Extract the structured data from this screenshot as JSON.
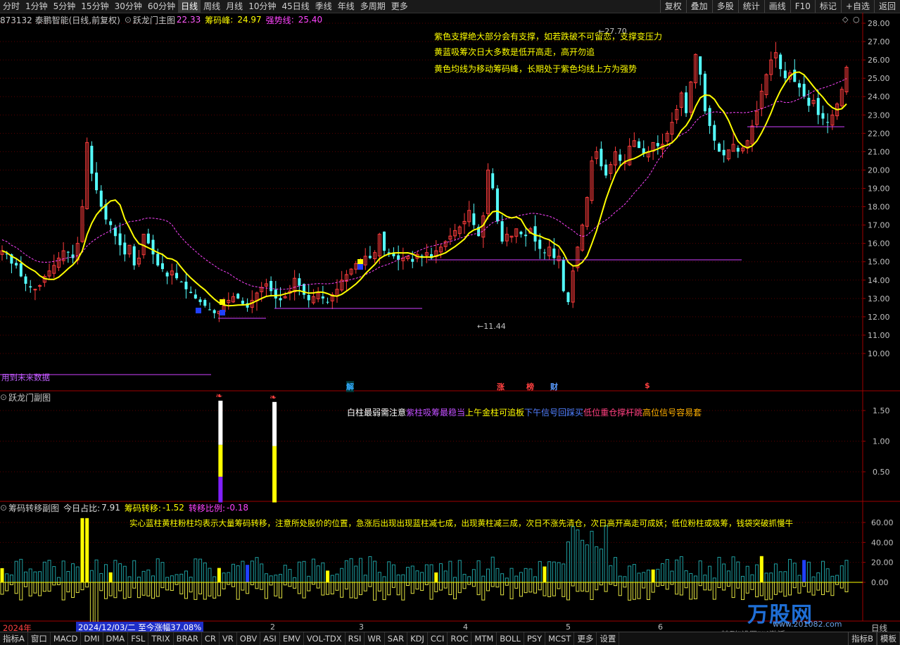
{
  "toolbar": {
    "periods": [
      "分时",
      "1分钟",
      "5分钟",
      "15分钟",
      "30分钟",
      "60分钟",
      "日线",
      "周线",
      "月线",
      "10分钟",
      "45日线",
      "季线",
      "年线",
      "多周期",
      "更多"
    ],
    "active_period": "日线",
    "right_items": [
      "复权",
      "叠加",
      "多股",
      "统计",
      "画线",
      "F10",
      "标记",
      "+自选",
      "返回"
    ]
  },
  "main_panel": {
    "stock": "873132 泰鹏智能(日线,前复权)",
    "indicator_name": "跃龙门主图",
    "value1": "22.33",
    "label2": "筹码峰",
    "value2": "24.97",
    "label3": "强势线",
    "value3": "25.40",
    "notes": [
      "紫色支撑绝大部分会有支撑，如若跌破不可留恋，支撑变压力",
      "黄蓝吸筹次日大多数是低开高走，高开勿追",
      "黄色均线为移动筹码峰，长期处于紫色均线上方为强势"
    ],
    "high_label": "27.70",
    "low_label": "11.44",
    "future_label": "用到未来数据",
    "signals": [
      "解",
      "涨",
      "榜",
      "财",
      "$"
    ]
  },
  "sub_panel": {
    "title": "跃龙门副图",
    "legend": [
      {
        "text": "白柱最弱需注意",
        "color": "#ffffff"
      },
      {
        "text": "紫柱吸筹最稳当",
        "color": "#c050ff"
      },
      {
        "text": "上午金柱可追板",
        "color": "#ffff00"
      },
      {
        "text": "下午信号回踩买",
        "color": "#5080ff"
      },
      {
        "text": "低位重仓撑杆跳",
        "color": "#ff4080"
      },
      {
        "text": "高位信号容易套",
        "color": "#ffb000"
      }
    ]
  },
  "transfer_panel": {
    "title": "筹码转移副图",
    "label1": "今日占比:",
    "value1": "7.91",
    "label2": "筹码转移:",
    "value2": "-1.52",
    "label3": "转移比例:",
    "value3": "-0.18",
    "note": "实心蓝柱黄柱粉柱均表示大量筹码转移，注意所处股价的位置，急涨后出现出现蓝柱减七成，出现黄柱减三成，次日不涨先清仓，次日高开高走可成妖；低位粉柱或吸筹，钱袋突破抓慢牛"
  },
  "time_axis": {
    "year": "2024年",
    "cursor_info": "2024/12/03/二 至今涨幅37.08%",
    "months": [
      "2",
      "3",
      "4",
      "5",
      "6"
    ],
    "right_label": "日线",
    "status_text": "转到\"设置\"以激活"
  },
  "bottom_toolbar": {
    "items": [
      "指标A",
      "窗口",
      "MACD",
      "DMI",
      "DMA",
      "FSL",
      "TRIX",
      "BRAR",
      "CR",
      "VR",
      "OBV",
      "ASI",
      "EMV",
      "VOL-TDX",
      "RSI",
      "WR",
      "SAR",
      "KDJ",
      "CCI",
      "ROC",
      "MTM",
      "BOLL",
      "PSY",
      "MCST",
      "更多",
      "设置"
    ],
    "right_items": [
      "指标B",
      "模板"
    ]
  },
  "watermark": {
    "brand": "万股网",
    "site": "www.201082.com"
  },
  "colors": {
    "up": "#ff3c3c",
    "down": "#54ffff",
    "ma": "#ffff00",
    "strong": "#ff44ff",
    "support": "#d040ff",
    "grid": "#5a0000",
    "axis": "#a00000"
  },
  "chart_data": [
    {
      "type": "candlestick",
      "y_axis_ticks": [
        "28.00",
        "27.00",
        "26.00",
        "25.00",
        "24.00",
        "23.00",
        "22.00",
        "21.00",
        "20.00",
        "19.00",
        "18.00",
        "17.00",
        "16.00",
        "15.00",
        "14.00",
        "13.00",
        "12.00",
        "11.00",
        "10.00"
      ],
      "ylim": [
        9.3,
        28.2
      ],
      "candles_count": 180,
      "close_series": [
        15.6,
        15.4,
        14.9,
        14.8,
        14.2,
        13.8,
        13.6,
        13.5,
        13.7,
        14.2,
        14.5,
        14.8,
        15.2,
        15.6,
        15.5,
        15.2,
        16.0,
        18.0,
        21.5,
        19.8,
        18.9,
        18.0,
        17.3,
        17.0,
        16.4,
        15.9,
        15.4,
        15.9,
        14.8,
        15.2,
        16.5,
        16.0,
        15.4,
        14.8,
        14.6,
        14.2,
        14.5,
        14.1,
        13.9,
        13.5,
        13.3,
        13.0,
        12.8,
        12.6,
        12.4,
        12.2,
        12.3,
        12.6,
        12.9,
        13.1,
        13.0,
        12.7,
        12.5,
        12.9,
        13.3,
        13.6,
        13.8,
        13.4,
        13.0,
        12.9,
        13.1,
        13.4,
        14.1,
        13.7,
        13.2,
        12.9,
        13.1,
        13.3,
        13.0,
        12.8,
        13.2,
        13.5,
        14.0,
        14.3,
        14.6,
        14.9,
        15.0,
        15.3,
        15.2,
        15.5,
        16.5,
        15.6,
        15.4,
        15.3,
        15.1,
        15.2,
        15.3,
        15.0,
        15.4,
        15.3,
        15.5,
        15.2,
        15.6,
        15.8,
        16.1,
        16.4,
        16.7,
        16.9,
        17.2,
        17.8,
        17.0,
        16.4,
        17.5,
        20.0,
        19.0,
        17.2,
        16.1,
        16.5,
        16.4,
        16.8,
        16.5,
        16.4,
        16.8,
        16.1,
        15.7,
        15.5,
        15.8,
        15.2,
        15.3,
        13.4,
        12.8,
        14.5,
        15.8,
        17.0,
        18.5,
        20.5,
        21.0,
        20.2,
        19.7,
        20.3,
        21.0,
        20.5,
        20.4,
        21.3,
        21.6,
        21.2,
        20.9,
        21.0,
        21.5,
        21.3,
        21.4,
        22.0,
        22.6,
        23.3,
        24.2,
        23.1,
        24.8,
        26.3,
        25.2,
        23.2,
        22.4,
        21.6,
        21.0,
        20.8,
        21.1,
        21.4,
        21.0,
        21.2,
        21.6,
        22.4,
        23.2,
        24.3,
        25.2,
        26.0,
        26.4,
        25.5,
        25.0,
        25.3,
        24.8,
        24.5,
        24.0,
        23.5,
        23.8,
        23.0,
        22.8,
        22.6,
        23.0,
        23.6,
        24.4,
        25.6
      ],
      "annotations": [
        "27.70",
        "11.44"
      ]
    },
    {
      "type": "bar",
      "y_axis_ticks": [
        "1.50",
        "1.00",
        "0.50"
      ],
      "ylim": [
        0,
        1.8
      ],
      "bars": [
        {
          "position": 0.245,
          "segments": [
            {
              "color": "#8020ff",
              "value": 0.42
            },
            {
              "color": "#ffff00",
              "value": 0.52
            },
            {
              "color": "#ffffff",
              "value": 0.72
            }
          ]
        },
        {
          "position": 0.305,
          "segments": [
            {
              "color": "#ffff00",
              "value": 0.92
            },
            {
              "color": "#ffffff",
              "value": 0.72
            }
          ]
        }
      ]
    },
    {
      "type": "bar",
      "y_axis_ticks": [
        "60.00",
        "40.00",
        "20.00",
        "0.00"
      ],
      "ylim": [
        -45,
        72
      ],
      "series_count": 180
    }
  ]
}
